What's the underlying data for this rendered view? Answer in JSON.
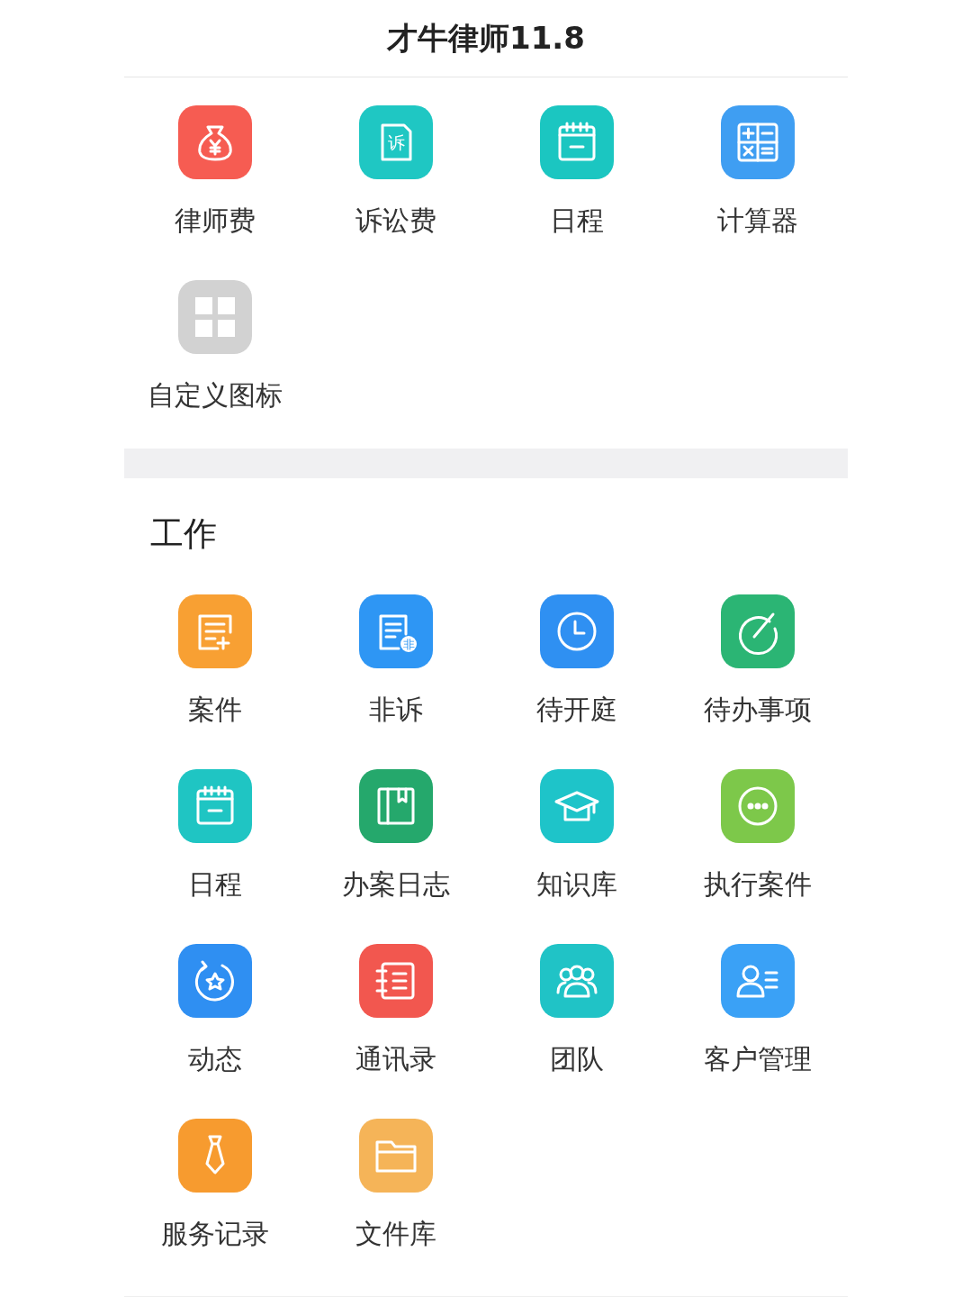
{
  "title": "才牛律师11.8",
  "shortcuts": [
    {
      "label": "律师费",
      "color": "#f65c52",
      "kind": "moneybag"
    },
    {
      "label": "诉讼费",
      "color": "#1fc7c3",
      "kind": "document",
      "glyph": "诉"
    },
    {
      "label": "日程",
      "color": "#1bc6c1",
      "kind": "calendar"
    },
    {
      "label": "计算器",
      "color": "#3f9ef2",
      "kind": "calculator"
    },
    {
      "label": "自定义图标",
      "color": "#d2d2d2",
      "kind": "grid"
    }
  ],
  "work": {
    "heading": "工作",
    "items": [
      {
        "label": "案件",
        "color": "#f8a033",
        "kind": "notepad"
      },
      {
        "label": "非诉",
        "color": "#2e96f4",
        "kind": "badgedoc",
        "glyph": "非"
      },
      {
        "label": "待开庭",
        "color": "#2f90f2",
        "kind": "clock"
      },
      {
        "label": "待办事项",
        "color": "#2bb574",
        "kind": "check"
      },
      {
        "label": "日程",
        "color": "#1fc5c3",
        "kind": "calendar"
      },
      {
        "label": "办案日志",
        "color": "#25a86c",
        "kind": "book"
      },
      {
        "label": "知识库",
        "color": "#1ec4c9",
        "kind": "cap"
      },
      {
        "label": "执行案件",
        "color": "#7dc84a",
        "kind": "chat"
      },
      {
        "label": "动态",
        "color": "#2f8ff2",
        "kind": "star"
      },
      {
        "label": "通讯录",
        "color": "#f2574f",
        "kind": "contacts"
      },
      {
        "label": "团队",
        "color": "#20c3c6",
        "kind": "team"
      },
      {
        "label": "客户管理",
        "color": "#3aa1f6",
        "kind": "client"
      },
      {
        "label": "服务记录",
        "color": "#f79b2f",
        "kind": "tie"
      },
      {
        "label": "文件库",
        "color": "#f5b458",
        "kind": "folder"
      }
    ]
  }
}
